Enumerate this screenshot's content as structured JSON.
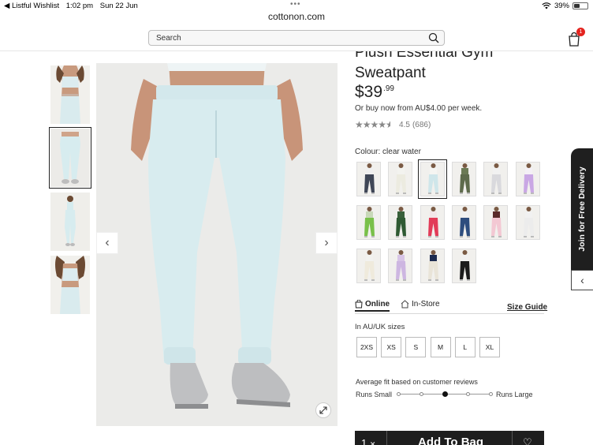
{
  "status_bar": {
    "back_app": "◀ Listful Wishlist",
    "time": "1:02 pm",
    "date": "Sun 22 Jun",
    "battery": "39%",
    "battery_level": 0.39
  },
  "browser": {
    "url": "cottonon.com"
  },
  "header": {
    "search_placeholder": "Search",
    "cart_count": "1"
  },
  "product": {
    "title": "Plush Essential Gym Sweatpant",
    "price_main": "$39",
    "price_cents": ".99",
    "bnpl": "Or buy now from AU$4.00 per week.",
    "rating_text": "4.5",
    "review_count": "(686)",
    "rating_value": 4.5
  },
  "colour": {
    "label": "Colour:",
    "selected": "clear water",
    "swatches": [
      {
        "pant": "#3f4656",
        "top": "#efefef"
      },
      {
        "pant": "#ecebe0",
        "top": "#f3f3ef"
      },
      {
        "pant": "#cfe6ea",
        "top": "#f5f5f2"
      },
      {
        "pant": "#5e6b4c",
        "top": "#6b7a55"
      },
      {
        "pant": "#d9d9dd",
        "top": "#f1f1f1"
      },
      {
        "pant": "#c9a7e4",
        "top": "#f4f0f6"
      },
      {
        "pant": "#79c04a",
        "top": "#c8d8b8"
      },
      {
        "pant": "#2f5a33",
        "top": "#385f3a"
      },
      {
        "pant": "#e23b58",
        "top": "#f2e6e8"
      },
      {
        "pant": "#2e4d7e",
        "top": "#f1f1f1"
      },
      {
        "pant": "#f3c8d3",
        "top": "#5a2a2a"
      },
      {
        "pant": "#ececec",
        "top": "#f1f1f1"
      },
      {
        "pant": "#efeadc",
        "top": "#f2f2ef"
      },
      {
        "pant": "#cdb6e1",
        "top": "#d7c4e6"
      },
      {
        "pant": "#e9e4d8",
        "top": "#1d2b50"
      },
      {
        "pant": "#1b1b1b",
        "top": "#f1f1f1"
      }
    ]
  },
  "delivery_tabs": [
    {
      "label": "Online"
    },
    {
      "label": "In-Store"
    }
  ],
  "size_guide": "Size Guide",
  "sizes": {
    "label": "In AU/UK sizes",
    "options": [
      "2XS",
      "XS",
      "S",
      "M",
      "L",
      "XL"
    ]
  },
  "fit": {
    "label": "Average fit based on customer reviews",
    "small": "Runs Small",
    "large": "Runs Large",
    "position": 0.5
  },
  "add_to_bag": {
    "qty": "1",
    "label": "Add To Bag"
  },
  "side_promo": "Join for Free Delivery"
}
